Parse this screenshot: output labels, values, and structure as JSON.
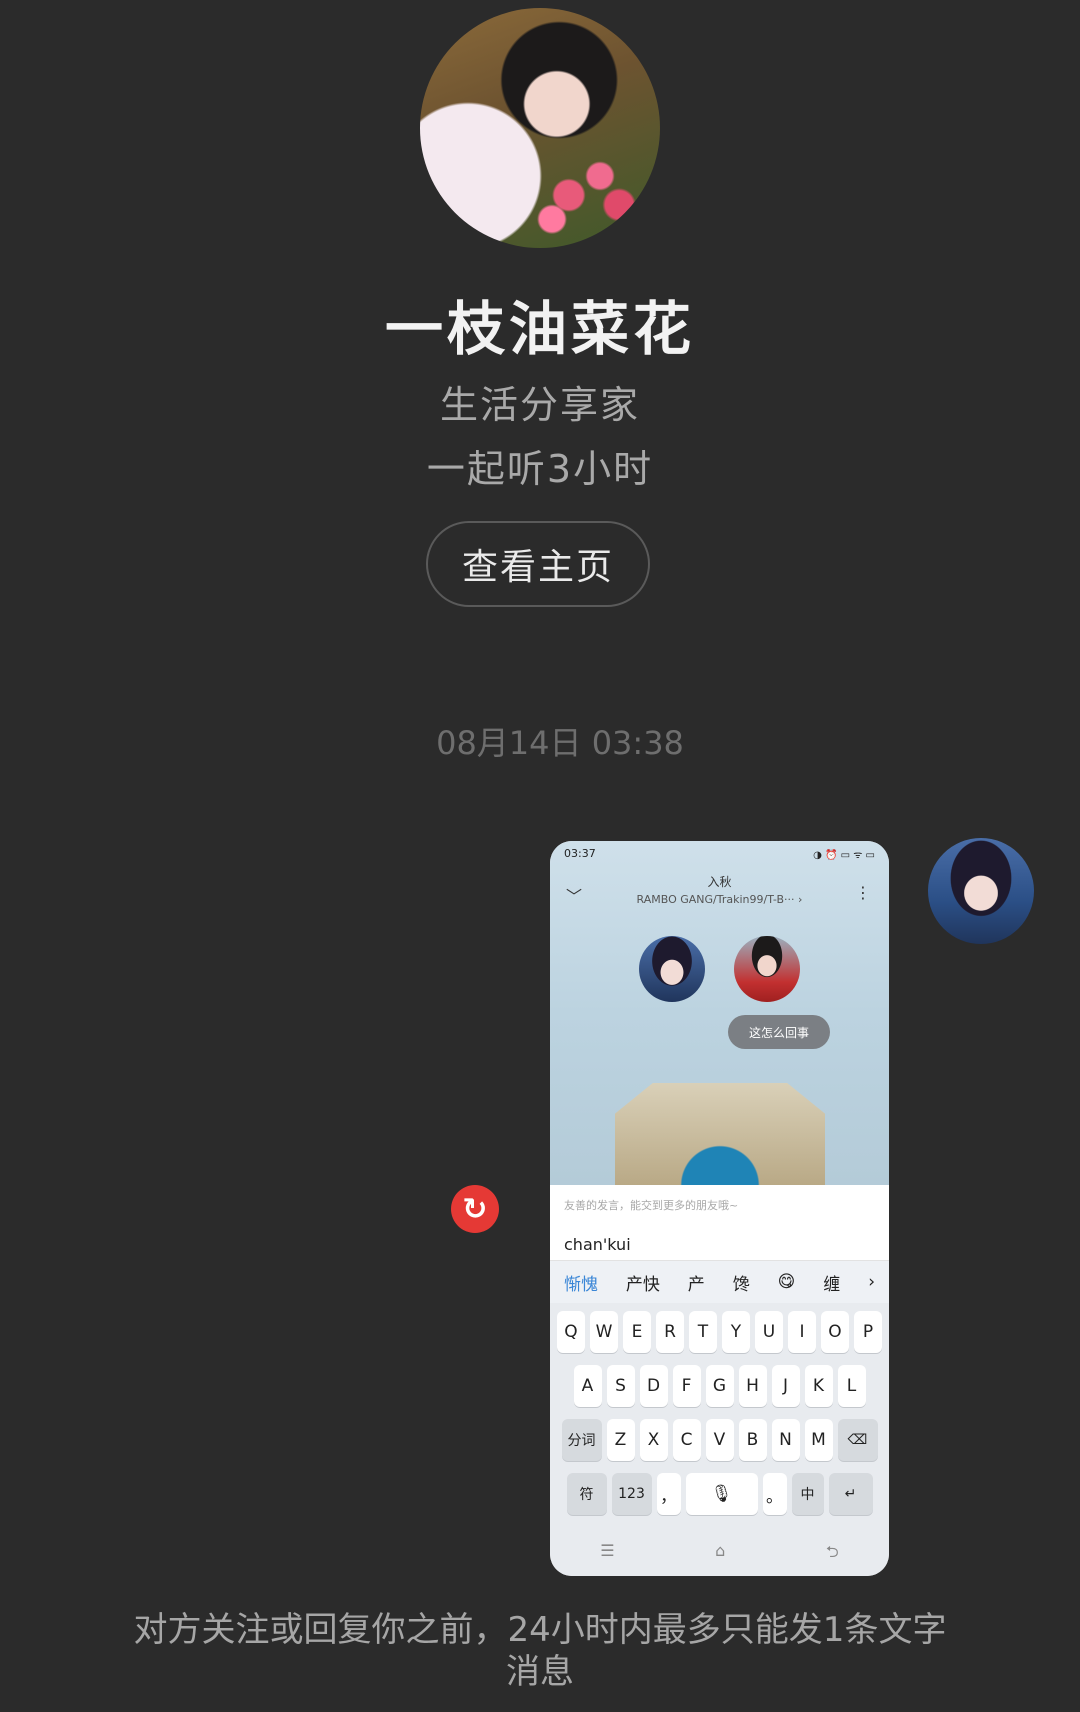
{
  "profile": {
    "name": "一枝油菜花",
    "bio": "生活分享家",
    "listen_time": "一起听3小时",
    "view_button": "查看主页"
  },
  "chat": {
    "timestamp": "08月14日 03:38",
    "retry_icon": "↻",
    "notice": "对方关注或回复你之前，24小时内最多只能发1条文字消息"
  },
  "screenshot_message": {
    "status_time": "03:37",
    "status_right": "◑ ⏰ ▭ ᯤ ▭",
    "back_icon": "﹀",
    "more_icon": "⋮",
    "song_title": "入秋",
    "artist": "RAMBO GANG/Trakin99/T-B··· ›",
    "bubble": "这怎么回事",
    "input_placeholder": "友善的发言，能交到更多的朋友哦~",
    "compose_text": "chan'kui",
    "candidates": [
      "惭愧",
      "产快",
      "产",
      "馋",
      "😋",
      "缠",
      "›"
    ],
    "row1": [
      "Q",
      "W",
      "E",
      "R",
      "T",
      "Y",
      "U",
      "I",
      "O",
      "P"
    ],
    "row2": [
      "A",
      "S",
      "D",
      "F",
      "G",
      "H",
      "J",
      "K",
      "L"
    ],
    "row3": [
      "分词",
      "Z",
      "X",
      "C",
      "V",
      "B",
      "N",
      "M",
      "⌫"
    ],
    "row4": [
      "符",
      "123",
      "，",
      "🎙",
      "。",
      "中",
      "↵"
    ],
    "nav": [
      "☰",
      "⌂",
      "⮌"
    ]
  }
}
